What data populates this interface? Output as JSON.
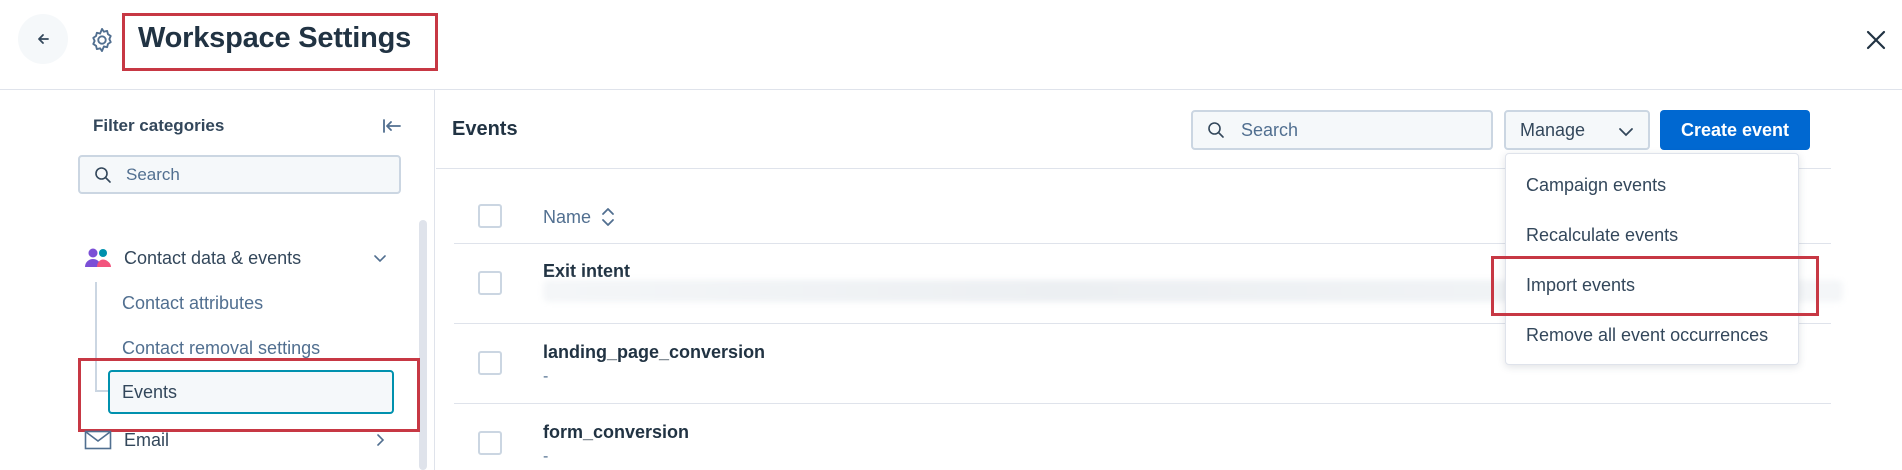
{
  "header": {
    "title": "Workspace Settings"
  },
  "sidebar": {
    "filter_title": "Filter categories",
    "search_placeholder": "Search",
    "categories": [
      {
        "label": "Contact data & events",
        "sub_items": [
          "Contact attributes",
          "Contact removal settings",
          "Events"
        ]
      },
      {
        "label": "Email"
      }
    ]
  },
  "main": {
    "title": "Events",
    "search_placeholder": "Search",
    "manage_label": "Manage",
    "create_label": "Create event",
    "table": {
      "column_name": "Name",
      "rows": [
        {
          "name": "Exit intent",
          "desc": ""
        },
        {
          "name": "landing_page_conversion",
          "desc": "-"
        },
        {
          "name": "form_conversion",
          "desc": "-"
        }
      ]
    }
  },
  "manage_menu": {
    "items": [
      "Campaign events",
      "Recalculate events",
      "Import events",
      "Remove all event occurrences"
    ]
  },
  "colors": {
    "primary": "#0068d1",
    "highlight": "#c73844",
    "focus": "#0091ae"
  }
}
